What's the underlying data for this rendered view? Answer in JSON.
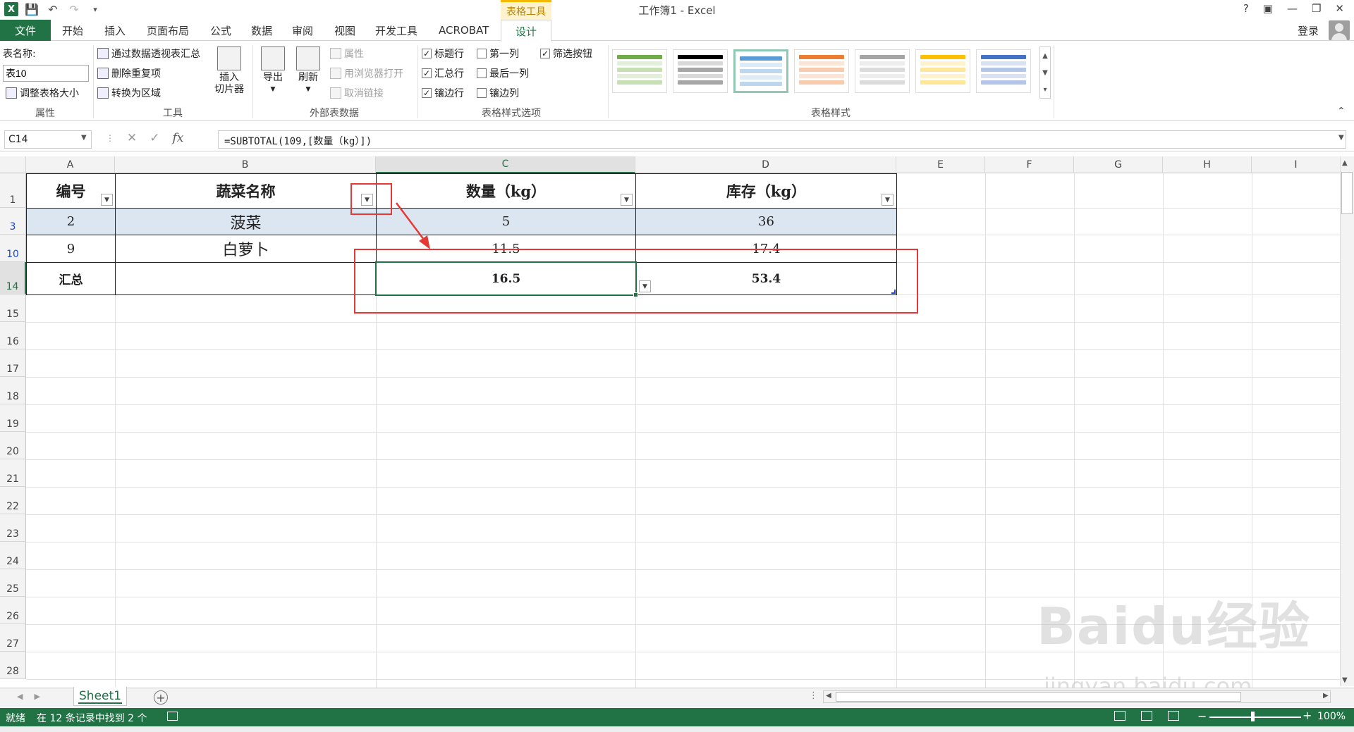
{
  "window": {
    "title": "工作簿1 - Excel",
    "context_tab": "表格工具",
    "help": "?",
    "login": "登录"
  },
  "tabs": [
    "开始",
    "插入",
    "页面布局",
    "公式",
    "数据",
    "审阅",
    "视图",
    "开发工具",
    "ACROBAT"
  ],
  "file_tab": "文件",
  "design_tab": "设计",
  "ribbon": {
    "properties": {
      "table_name_label": "表名称:",
      "table_name_value": "表10",
      "resize": "调整表格大小",
      "group": "属性"
    },
    "tools": {
      "pivot": "通过数据透视表汇总",
      "remove_dup": "删除重复项",
      "convert": "转换为区域",
      "slicer_line1": "插入",
      "slicer_line2": "切片器",
      "group": "工具"
    },
    "external": {
      "export": "导出",
      "refresh": "刷新",
      "properties": "属性",
      "browser": "用浏览器打开",
      "unlink": "取消链接",
      "group": "外部表数据"
    },
    "style_options": {
      "header_row": "标题行",
      "total_row": "汇总行",
      "banded_rows": "镶边行",
      "first_col": "第一列",
      "last_col": "最后一列",
      "banded_cols": "镶边列",
      "filter_btn": "筛选按钮",
      "group": "表格样式选项"
    },
    "styles": {
      "group": "表格样式"
    }
  },
  "formula_bar": {
    "name_box": "C14",
    "formula": "=SUBTOTAL(109,[数量（kg）])",
    "fx": "fx"
  },
  "columns": [
    "A",
    "B",
    "C",
    "D",
    "E",
    "F",
    "G",
    "H",
    "I"
  ],
  "rows": [
    "1",
    "3",
    "10",
    "14",
    "15",
    "16",
    "17",
    "18",
    "19",
    "20",
    "21",
    "22",
    "23",
    "24",
    "25",
    "26",
    "27",
    "28"
  ],
  "table": {
    "headers": [
      "编号",
      "蔬菜名称",
      "数量（kg）",
      "库存（kg）"
    ],
    "data": [
      [
        "2",
        "菠菜",
        "5",
        "36"
      ],
      [
        "9",
        "白萝卜",
        "11.5",
        "17.4"
      ]
    ],
    "total": [
      "汇总",
      "",
      "16.5",
      "53.4"
    ]
  },
  "sheet": {
    "tab": "Sheet1"
  },
  "status": {
    "ready": "就绪",
    "found": "在 12 条记录中找到 2 个",
    "zoom": "100%"
  },
  "watermark": {
    "brand": "Baidu经验",
    "url": "jingyan.baidu.com"
  },
  "colors": {
    "excel_green": "#217346",
    "banded": "#dce6f1",
    "annotation_red": "#e53935"
  }
}
